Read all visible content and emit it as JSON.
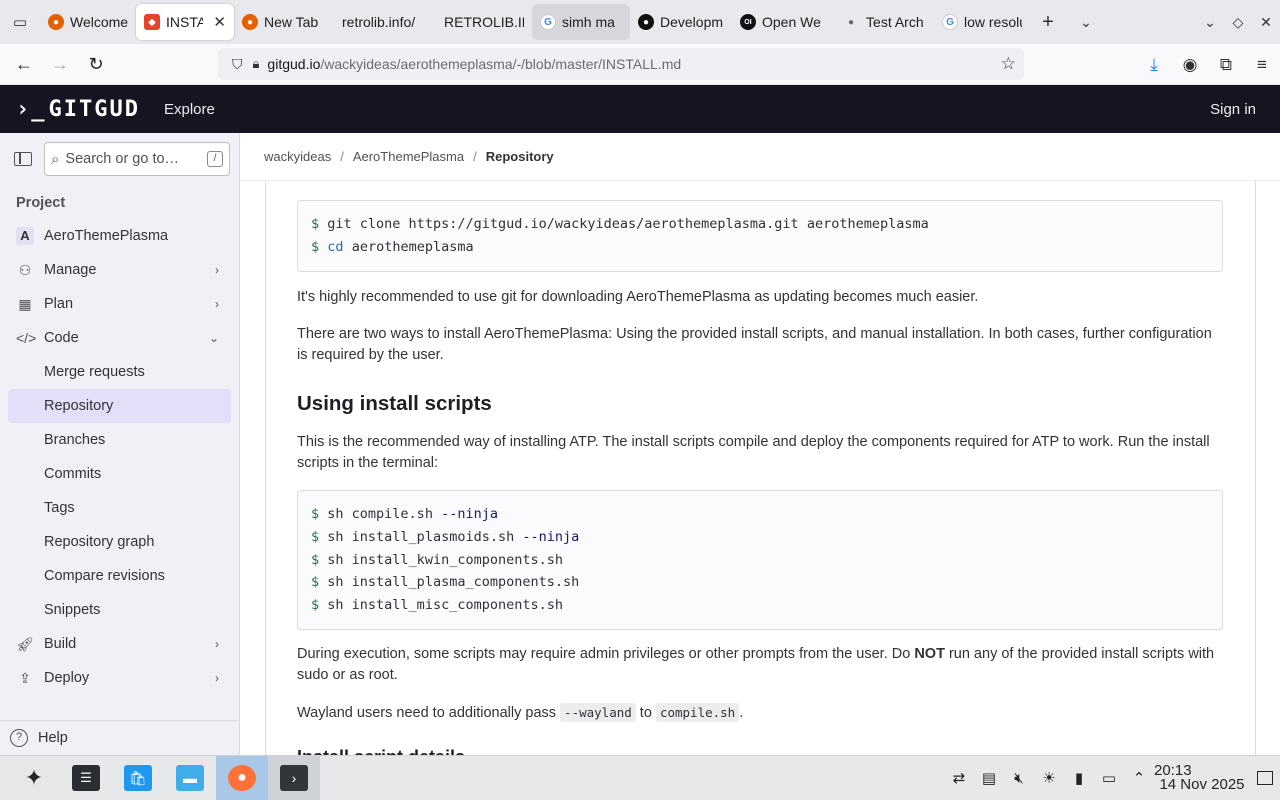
{
  "browser": {
    "tabs": [
      {
        "label": "Welcome",
        "favicon": "firefox-icon",
        "color": "#e66000"
      },
      {
        "label": "INSTALL",
        "favicon": "gitlab-icon",
        "color": "#e24329",
        "active": true
      },
      {
        "label": "New Tab",
        "favicon": "firefox-icon",
        "color": "#e66000"
      },
      {
        "label": "retrolib.info/",
        "favicon": "none"
      },
      {
        "label": "RETROLIB.IN",
        "favicon": "none"
      },
      {
        "label": "simh ma",
        "favicon": "google-icon",
        "color": "#4285f4"
      },
      {
        "label": "Developm",
        "favicon": "github-icon",
        "color": "#111111"
      },
      {
        "label": "Open We",
        "favicon": "openwebui-icon",
        "color": "#111111"
      },
      {
        "label": "Test Arch",
        "favicon": "dot-icon"
      },
      {
        "label": "low resolu",
        "favicon": "google-icon",
        "color": "#4285f4"
      }
    ],
    "url_host": "gitgud.io",
    "url_path": "/wackyideas/aerothemeplasma/-/blob/master/INSTALL.md"
  },
  "header": {
    "logo": "GITGUD",
    "explore": "Explore",
    "sign_in": "Sign in"
  },
  "sidebar": {
    "search_placeholder": "Search or go to…",
    "search_shortcut": "/",
    "section": "Project",
    "project": {
      "initial": "A",
      "name": "AeroThemePlasma"
    },
    "items": [
      {
        "label": "Manage",
        "icon": "users-icon"
      },
      {
        "label": "Plan",
        "icon": "calendar-icon"
      },
      {
        "label": "Code",
        "icon": "code-icon"
      }
    ],
    "code_sub": [
      "Merge requests",
      "Repository",
      "Branches",
      "Commits",
      "Tags",
      "Repository graph",
      "Compare revisions",
      "Snippets"
    ],
    "items_after": [
      {
        "label": "Build",
        "icon": "rocket-icon"
      },
      {
        "label": "Deploy",
        "icon": "deploy-icon"
      }
    ],
    "help": "Help"
  },
  "breadcrumb": [
    "wackyideas",
    "AeroThemePlasma",
    "Repository"
  ],
  "content": {
    "clone_block": {
      "line1_cmd": "git clone https://gitgud.io/wackyideas/aerothemeplasma.git aerothemeplasma",
      "line2_kw": "cd",
      "line2_arg": "aerothemeplasma"
    },
    "p1": "It's highly recommended to use git for downloading AeroThemePlasma as updating becomes much easier.",
    "p2": "There are two ways to install AeroThemePlasma: Using the provided install scripts, and manual installation. In both cases, further configuration is required by the user.",
    "h2": "Using install scripts",
    "p3": "This is the recommended way of installing ATP. The install scripts compile and deploy the components required for ATP to work. Run the install scripts in the terminal:",
    "script_block": [
      {
        "cmd": "sh compile.sh ",
        "flag": "--ninja"
      },
      {
        "cmd": "sh install_plasmoids.sh ",
        "flag": "--ninja"
      },
      {
        "cmd": "sh install_kwin_components.sh",
        "flag": ""
      },
      {
        "cmd": "sh install_plasma_components.sh",
        "flag": ""
      },
      {
        "cmd": "sh install_misc_components.sh",
        "flag": ""
      }
    ],
    "prompt": "$",
    "p4_a": "During execution, some scripts may require admin privileges or other prompts from the user. Do ",
    "p4_b": "NOT",
    "p4_c": " run any of the provided install scripts with sudo or as root.",
    "p5_a": "Wayland users need to additionally pass ",
    "p5_code1": "--wayland",
    "p5_b": " to ",
    "p5_code2": "compile.sh",
    "p5_c": ".",
    "next_heading": "Install script details"
  },
  "taskbar": {
    "time": "20:13",
    "date": "14 Nov 2025"
  }
}
